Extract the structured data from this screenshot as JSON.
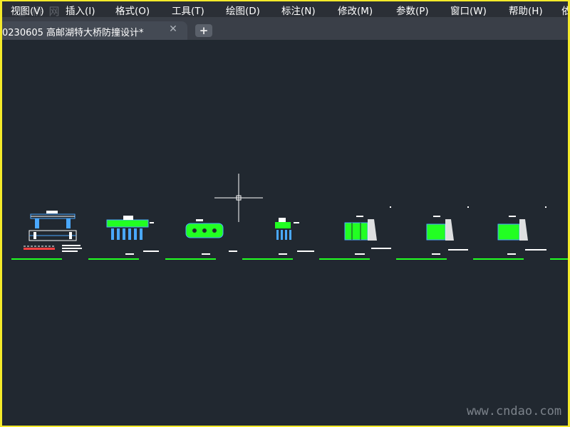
{
  "menu": {
    "items": [
      "视图(V)",
      "插入(I)",
      "格式(O)",
      "工具(T)",
      "绘图(D)",
      "标注(N)",
      "修改(M)",
      "参数(P)",
      "窗口(W)",
      "帮助(H)",
      "依"
    ]
  },
  "watermark_top": "道 桥 网",
  "tabs": {
    "active_label": "0230605 高邮湖特大桥防撞设计*",
    "close_glyph": "✕",
    "add_glyph": "+"
  },
  "watermark_bottom": "www.cndao.com",
  "colors": {
    "background": "#212830",
    "frame_border": "#f4ea2a",
    "drawing_green": "#22ff22",
    "drawing_white": "#ffffff",
    "drawing_blue": "#4aa8ff",
    "drawing_red": "#ff4040"
  },
  "canvas": {
    "drawing_count": 7
  }
}
